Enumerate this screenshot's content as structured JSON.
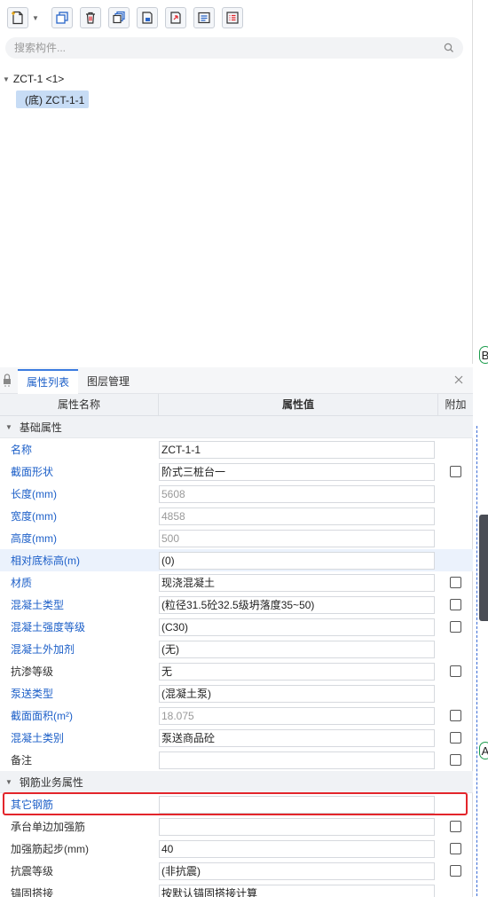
{
  "search": {
    "placeholder": "搜索构件..."
  },
  "tree": {
    "root_label": "ZCT-1 <1>",
    "child_label": "(底) ZCT-1-1"
  },
  "edge": {
    "marker1": "B",
    "marker2": "A"
  },
  "tabs": [
    {
      "label": "属性列表"
    },
    {
      "label": "图层管理"
    }
  ],
  "grid": {
    "headers": {
      "name": "属性名称",
      "value": "属性值",
      "add": "附加"
    },
    "groups": [
      {
        "label": "基础属性",
        "rows": [
          {
            "name": "名称",
            "value": "ZCT-1-1",
            "gray": false,
            "check": false
          },
          {
            "name": "截面形状",
            "value": "阶式三桩台一",
            "gray": false,
            "check": true
          },
          {
            "name": "长度(mm)",
            "value": "5608",
            "gray": true,
            "check": false
          },
          {
            "name": "宽度(mm)",
            "value": "4858",
            "gray": true,
            "check": false
          },
          {
            "name": "高度(mm)",
            "value": "500",
            "gray": true,
            "check": false
          },
          {
            "name": "相对底标高(m)",
            "value": "(0)",
            "gray": false,
            "check": false,
            "selected": true
          },
          {
            "name": "材质",
            "value": "现浇混凝土",
            "gray": false,
            "check": true
          },
          {
            "name": "混凝土类型",
            "value": "(粒径31.5砼32.5级坍落度35~50)",
            "gray": false,
            "check": true
          },
          {
            "name": "混凝土强度等级",
            "value": "(C30)",
            "gray": false,
            "check": true
          },
          {
            "name": "混凝土外加剂",
            "value": "(无)",
            "gray": false,
            "check": false
          },
          {
            "name": "抗渗等级",
            "value": "无",
            "gray": false,
            "check": true,
            "black": true
          },
          {
            "name": "泵送类型",
            "value": "(混凝土泵)",
            "gray": false,
            "check": false
          },
          {
            "name": "截面面积(m²)",
            "value": "18.075",
            "gray": true,
            "check": true
          },
          {
            "name": "混凝土类别",
            "value": "泵送商品砼",
            "gray": false,
            "check": true
          },
          {
            "name": "备注",
            "value": "",
            "gray": false,
            "check": true,
            "black": true
          }
        ]
      },
      {
        "label": "钢筋业务属性",
        "rows": [
          {
            "name": "其它钢筋",
            "value": "",
            "gray": false,
            "check": false
          },
          {
            "name": "承台单边加强筋",
            "value": "",
            "gray": false,
            "check": true,
            "black": true
          },
          {
            "name": "加强筋起步(mm)",
            "value": "40",
            "gray": false,
            "check": true,
            "black": true
          },
          {
            "name": "抗震等级",
            "value": "(非抗震)",
            "gray": false,
            "check": true,
            "black": true
          },
          {
            "name": "锚固搭接",
            "value": "按默认锚固搭接计算",
            "gray": false,
            "check": false,
            "black": true
          }
        ]
      }
    ]
  }
}
